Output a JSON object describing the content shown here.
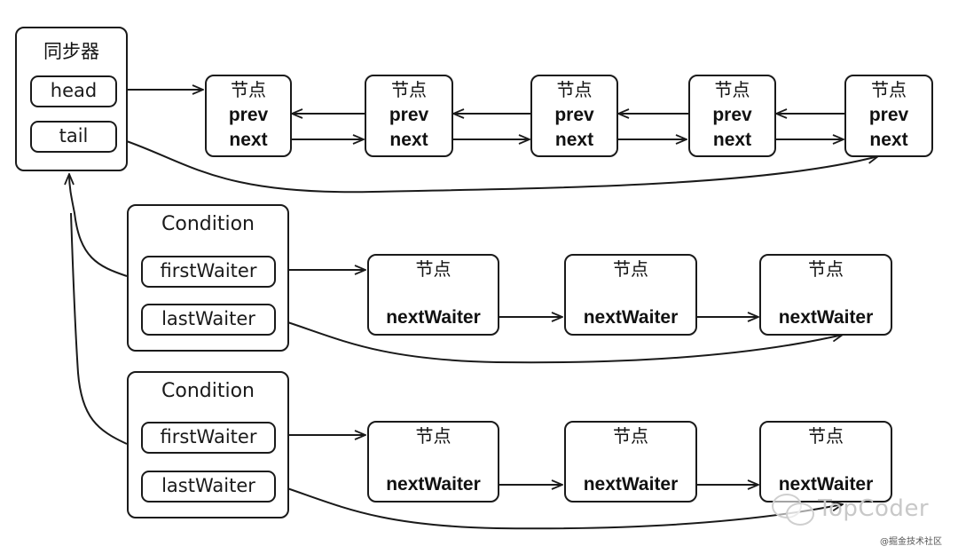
{
  "sync": {
    "title": "同步器",
    "head": "head",
    "tail": "tail"
  },
  "sync_queue": {
    "nodes": [
      {
        "label": "节点",
        "prev": "prev",
        "next": "next"
      },
      {
        "label": "节点",
        "prev": "prev",
        "next": "next"
      },
      {
        "label": "节点",
        "prev": "prev",
        "next": "next"
      },
      {
        "label": "节点",
        "prev": "prev",
        "next": "next"
      },
      {
        "label": "节点",
        "prev": "prev",
        "next": "next"
      }
    ]
  },
  "conditions": [
    {
      "title": "Condition",
      "first": "firstWaiter",
      "last": "lastWaiter",
      "nodes": [
        {
          "label": "节点",
          "field": "nextWaiter"
        },
        {
          "label": "节点",
          "field": "nextWaiter"
        },
        {
          "label": "节点",
          "field": "nextWaiter"
        }
      ]
    },
    {
      "title": "Condition",
      "first": "firstWaiter",
      "last": "lastWaiter",
      "nodes": [
        {
          "label": "节点",
          "field": "nextWaiter"
        },
        {
          "label": "节点",
          "field": "nextWaiter"
        },
        {
          "label": "节点",
          "field": "nextWaiter"
        }
      ]
    }
  ],
  "watermark": {
    "brand": "TopCoder",
    "credit": "@掘金技术社区"
  }
}
